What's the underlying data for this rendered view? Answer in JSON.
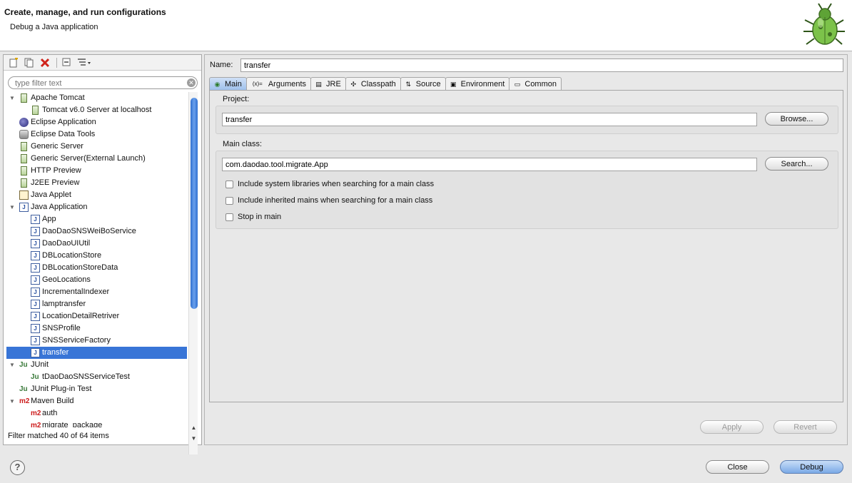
{
  "header": {
    "title": "Create, manage, and run configurations",
    "subtitle": "Debug a Java application"
  },
  "left": {
    "filter_placeholder": "type filter text",
    "status": "Filter matched 40 of 64 items",
    "tree": [
      {
        "label": "Apache Tomcat",
        "level": 0,
        "expander": "open",
        "icon": "server-icon"
      },
      {
        "label": "Tomcat v6.0 Server at localhost",
        "level": 1,
        "icon": "server-icon"
      },
      {
        "label": "Eclipse Application",
        "level": 0,
        "icon": "eclipse-icon"
      },
      {
        "label": "Eclipse Data Tools",
        "level": 0,
        "icon": "database-icon"
      },
      {
        "label": "Generic Server",
        "level": 0,
        "icon": "server-icon"
      },
      {
        "label": "Generic Server(External Launch)",
        "level": 0,
        "icon": "server-icon"
      },
      {
        "label": "HTTP Preview",
        "level": 0,
        "icon": "server-icon"
      },
      {
        "label": "J2EE Preview",
        "level": 0,
        "icon": "server-icon"
      },
      {
        "label": "Java Applet",
        "level": 0,
        "icon": "applet-icon"
      },
      {
        "label": "Java Application",
        "level": 0,
        "expander": "open",
        "icon": "java-app-icon"
      },
      {
        "label": "App",
        "level": 1,
        "icon": "java-app-icon"
      },
      {
        "label": "DaoDaoSNSWeiBoService",
        "level": 1,
        "icon": "java-app-icon"
      },
      {
        "label": "DaoDaoUIUtil",
        "level": 1,
        "icon": "java-app-icon"
      },
      {
        "label": "DBLocationStore",
        "level": 1,
        "icon": "java-app-icon"
      },
      {
        "label": "DBLocationStoreData",
        "level": 1,
        "icon": "java-app-icon"
      },
      {
        "label": "GeoLocations",
        "level": 1,
        "icon": "java-app-icon"
      },
      {
        "label": "IncrementalIndexer",
        "level": 1,
        "icon": "java-app-icon"
      },
      {
        "label": "lamptransfer",
        "level": 1,
        "icon": "java-app-icon"
      },
      {
        "label": "LocationDetailRetriver",
        "level": 1,
        "icon": "java-app-icon"
      },
      {
        "label": "SNSProfile",
        "level": 1,
        "icon": "java-app-icon"
      },
      {
        "label": "SNSServiceFactory",
        "level": 1,
        "icon": "java-app-icon"
      },
      {
        "label": "transfer",
        "level": 1,
        "icon": "java-app-icon",
        "selected": true
      },
      {
        "label": "JUnit",
        "level": 0,
        "expander": "open",
        "icon": "junit-icon"
      },
      {
        "label": "tDaoDaoSNSServiceTest",
        "level": 1,
        "icon": "junit-icon"
      },
      {
        "label": "JUnit Plug-in Test",
        "level": 0,
        "icon": "junit-icon"
      },
      {
        "label": "Maven Build",
        "level": 0,
        "expander": "open",
        "icon": "maven-icon"
      },
      {
        "label": "auth",
        "level": 1,
        "icon": "maven-icon"
      },
      {
        "label": "migrate_package",
        "level": 1,
        "icon": "maven-icon"
      }
    ]
  },
  "right": {
    "name_label": "Name:",
    "name_value": "transfer",
    "tabs": [
      {
        "label": "Main",
        "icon": "main-tab-icon",
        "glyph": "◉",
        "active": true
      },
      {
        "label": "Arguments",
        "icon": "arguments-icon",
        "glyph": "(x)="
      },
      {
        "label": "JRE",
        "icon": "jre-icon",
        "glyph": "▤"
      },
      {
        "label": "Classpath",
        "icon": "classpath-icon",
        "glyph": "✣"
      },
      {
        "label": "Source",
        "icon": "source-icon",
        "glyph": "⇅"
      },
      {
        "label": "Environment",
        "icon": "environment-icon",
        "glyph": "▣"
      },
      {
        "label": "Common",
        "icon": "common-icon",
        "glyph": "▭"
      }
    ],
    "project_label": "Project:",
    "project_value": "transfer",
    "browse_label": "Browse...",
    "main_class_label": "Main class:",
    "main_class_value": "com.daodao.tool.migrate.App",
    "search_label": "Search...",
    "checkboxes": [
      {
        "label": "Include system libraries when searching for a main class",
        "checked": false
      },
      {
        "label": "Include inherited mains when searching for a main class",
        "checked": false
      },
      {
        "label": "Stop in main",
        "checked": false
      }
    ],
    "apply_label": "Apply",
    "revert_label": "Revert"
  },
  "footer": {
    "help_glyph": "?",
    "close_label": "Close",
    "debug_label": "Debug"
  }
}
